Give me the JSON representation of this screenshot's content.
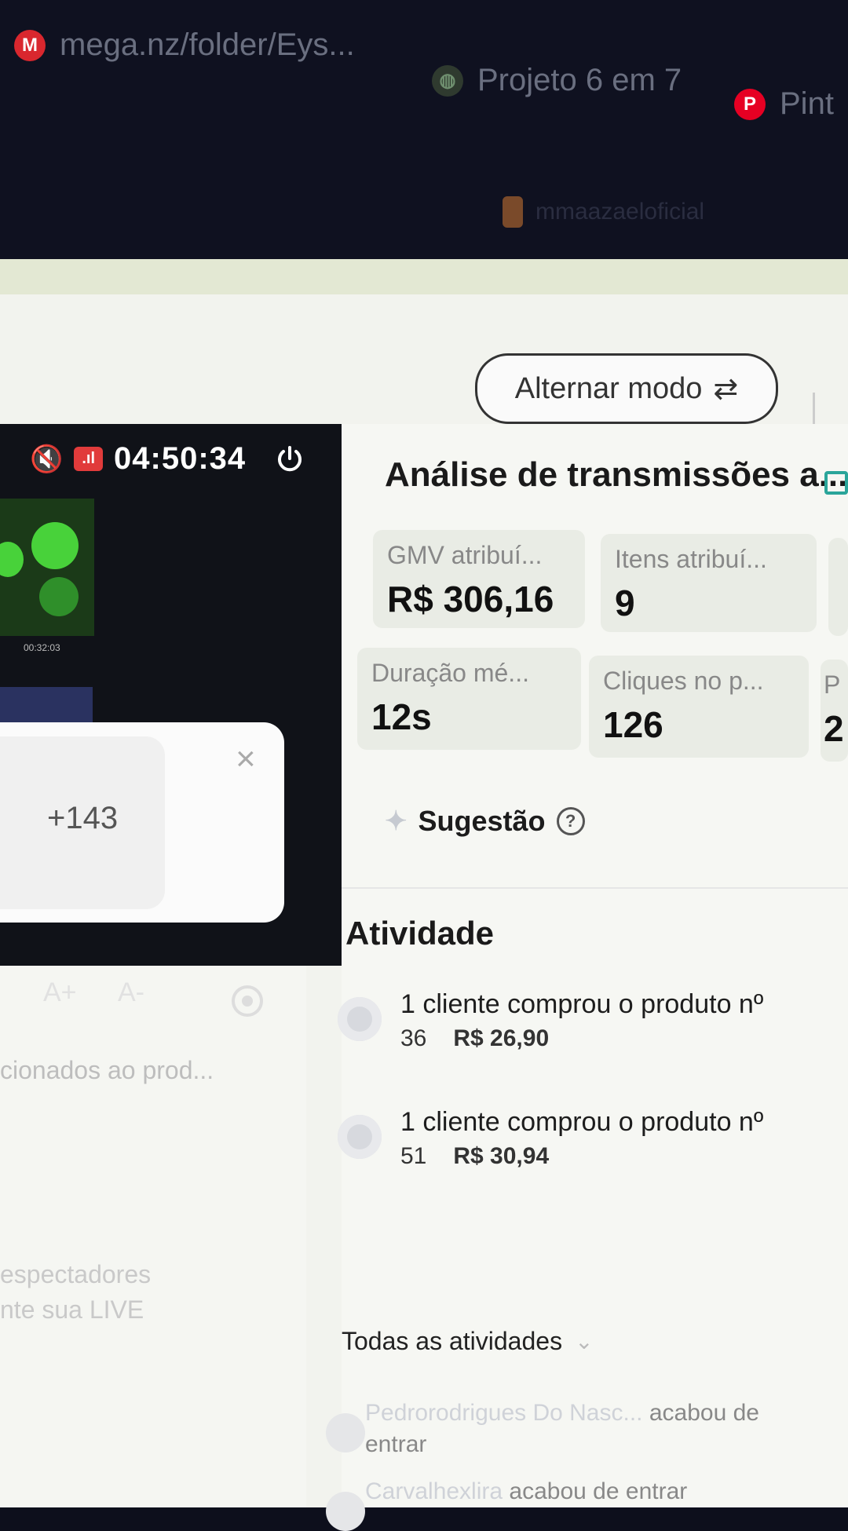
{
  "bookmarks": [
    {
      "label": "mega.nz/folder/Eys...",
      "icon": "mega-icon",
      "glyph": "M",
      "color": "#d9272e"
    },
    {
      "label": "Projeto 6 em 7",
      "icon": "globe-icon",
      "glyph": "◍",
      "color": "#3a5a3a"
    },
    {
      "label": "Pint",
      "icon": "pinterest-icon",
      "glyph": "P",
      "color": "#e60023"
    }
  ],
  "header": {
    "profile_name": "mmaazaeloficial"
  },
  "mode_button": {
    "label": "Alternar modo",
    "icon": "⇄"
  },
  "live": {
    "timer": "04:50:34",
    "signal": ".ıl",
    "mute_icon": "🔇",
    "thumb_time": "00:32:03"
  },
  "popup": {
    "count": "+143",
    "close": "×"
  },
  "left": {
    "font_controls": [
      "A+",
      "A-"
    ],
    "product_text": "cionados ao prod...",
    "viewers_text_1": "espectadores",
    "viewers_text_2": "nte sua LIVE"
  },
  "panel": {
    "title": "Análise de transmissões a...",
    "metrics": [
      {
        "label": "GMV atribuí...",
        "value": "R$ 306,16"
      },
      {
        "label": "Itens atribuí...",
        "value": "9"
      },
      {
        "label": "Duração mé...",
        "value": "12s"
      },
      {
        "label": "Cliques no p...",
        "value": "126"
      },
      {
        "label": "P",
        "value": "2"
      }
    ],
    "suggestion_label": "Sugestão",
    "help": "?"
  },
  "activity": {
    "title": "Atividade",
    "items": [
      {
        "text": "1 cliente comprou o produto nº",
        "number": "36",
        "price": "R$ 26,90"
      },
      {
        "text": "1 cliente comprou o produto nº",
        "number": "51",
        "price": "R$ 30,94"
      }
    ],
    "all_label": "Todas as atividades",
    "entries": [
      {
        "name": "Pedrorodrigues Do Nasc...",
        "action": "acabou de entrar"
      },
      {
        "name": "Carvalhexlira",
        "action": "acabou de entrar"
      }
    ]
  },
  "colors": {
    "accent": "#2aa59a",
    "live_badge": "#e13b3b",
    "preview_bg": "#101218"
  }
}
